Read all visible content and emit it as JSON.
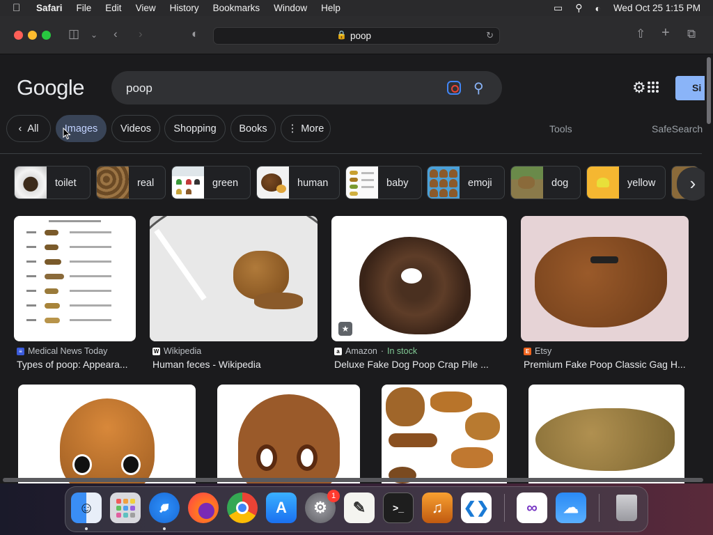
{
  "menubar": {
    "app": "Safari",
    "items": [
      "File",
      "Edit",
      "View",
      "History",
      "Bookmarks",
      "Window",
      "Help"
    ],
    "datetime": "Wed Oct 25  1:15 PM"
  },
  "toolbar": {
    "url": "poop"
  },
  "google": {
    "logo": "Google",
    "query": "poop",
    "signin": "Si"
  },
  "tabs": [
    {
      "label": "All"
    },
    {
      "label": "Images"
    },
    {
      "label": "Videos"
    },
    {
      "label": "Shopping"
    },
    {
      "label": "Books"
    },
    {
      "label": "More"
    }
  ],
  "tools": "Tools",
  "safesearch": "SafeSearch",
  "chips": [
    "toilet",
    "real",
    "green",
    "human",
    "baby",
    "emoji",
    "dog",
    "yellow"
  ],
  "results": [
    {
      "source": "Medical News Today",
      "title": "Types of poop: Appeara..."
    },
    {
      "source": "Wikipedia",
      "title": "Human feces - Wikipedia"
    },
    {
      "source": "Amazon",
      "stock": "In stock",
      "title": "Deluxe Fake Dog Poop Crap Pile ..."
    },
    {
      "source": "Etsy",
      "title": "Premium Fake Poop Classic Gag H..."
    }
  ],
  "dock": {
    "settings_badge": "1"
  },
  "colors": {
    "accent": "#8ab4f8",
    "active_tab": "#394457",
    "stock": "#81c995"
  }
}
